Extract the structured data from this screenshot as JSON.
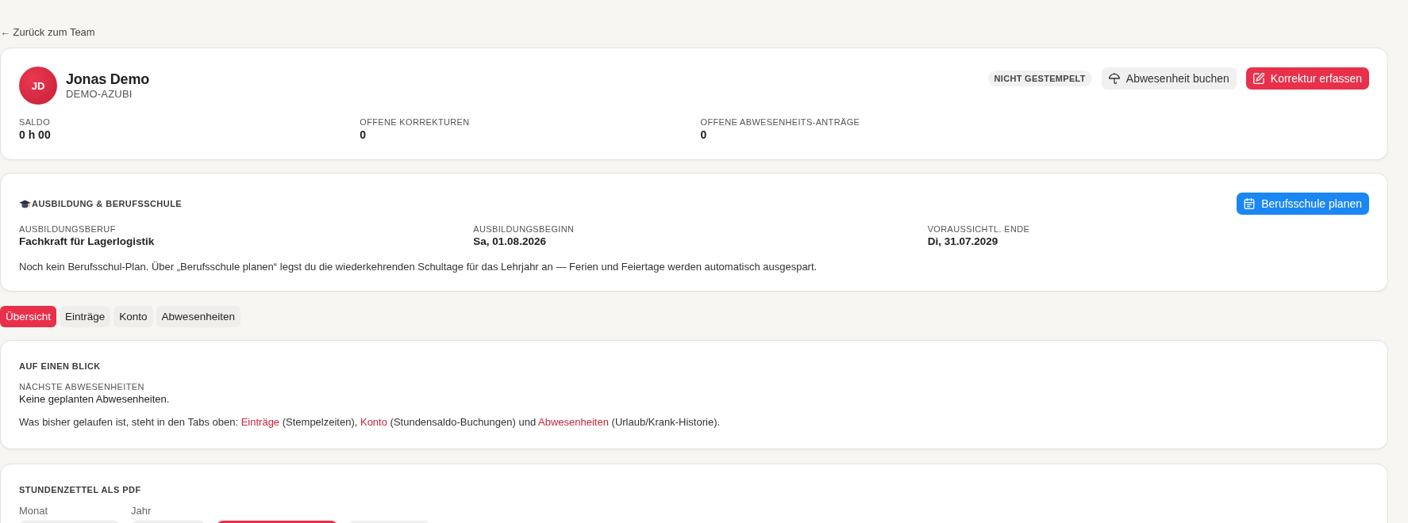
{
  "back_link": {
    "label": "← Zurück zum Team"
  },
  "profile": {
    "initials": "JD",
    "name": "Jonas Demo",
    "role": "DEMO-AZUBI",
    "status_badge": "NICHT GESTEMPELT",
    "actions": [
      {
        "label": "Abwesenheit buchen",
        "kind": "secondary"
      },
      {
        "label": "Korrektur erfassen",
        "kind": "primary"
      }
    ],
    "stats": [
      {
        "label": "SALDO",
        "value": "0 h 00"
      },
      {
        "label": "OFFENE KORREKTUREN",
        "value": "0"
      },
      {
        "label": "OFFENE ABWESENHEITS-ANTRÄGE",
        "value": "0"
      }
    ]
  },
  "training": {
    "title": "AUSBILDUNG & BERUFSSCHULE",
    "action": {
      "label": "Berufsschule planen",
      "kind": "info"
    },
    "fields": [
      {
        "label": "AUSBILDUNGSBERUF",
        "value": "Fachkraft für Lagerlogistik"
      },
      {
        "label": "AUSBILDUNGSBEGINN",
        "value": "Sa, 01.08.2026"
      },
      {
        "label": "VORAUSSICHTL. ENDE",
        "value": "Di, 31.07.2029"
      }
    ],
    "note": "Noch kein Berufsschul-Plan. Über „Berufsschule planen“ legst du die wiederkehrenden Schultage für das Lehrjahr an — Ferien und Feiertage werden automatisch ausgespart."
  },
  "tabs": [
    {
      "label": "Übersicht",
      "selected": true
    },
    {
      "label": "Einträge",
      "selected": false
    },
    {
      "label": "Konto",
      "selected": false
    },
    {
      "label": "Abwesenheiten",
      "selected": false
    }
  ],
  "overview": {
    "title": "AUF EINEN BLICK",
    "next_absences": {
      "label": "NÄCHSTE ABWESENHEITEN",
      "value": "Keine geplanten Abwesenheiten."
    },
    "hint": [
      {
        "kind": "text",
        "text": "Was bisher gelaufen ist, steht in den Tabs oben: "
      },
      {
        "kind": "link",
        "text": "Einträge"
      },
      {
        "kind": "text",
        "text": " (Stempelzeiten), "
      },
      {
        "kind": "link",
        "text": "Konto"
      },
      {
        "kind": "text",
        "text": " (Stundensaldo-Buchungen) und "
      },
      {
        "kind": "link",
        "text": "Abwesenheiten"
      },
      {
        "kind": "text",
        "text": " (Urlaub/Krank-Historie)."
      }
    ]
  },
  "timesheet": {
    "title": "STUNDENZETTEL ALS PDF",
    "fields": [
      {
        "label": "Monat",
        "kind": "select"
      },
      {
        "label": "Jahr",
        "kind": "select"
      }
    ],
    "buttons": [
      {
        "kind": "primary"
      },
      {
        "kind": "secondary"
      }
    ]
  }
}
